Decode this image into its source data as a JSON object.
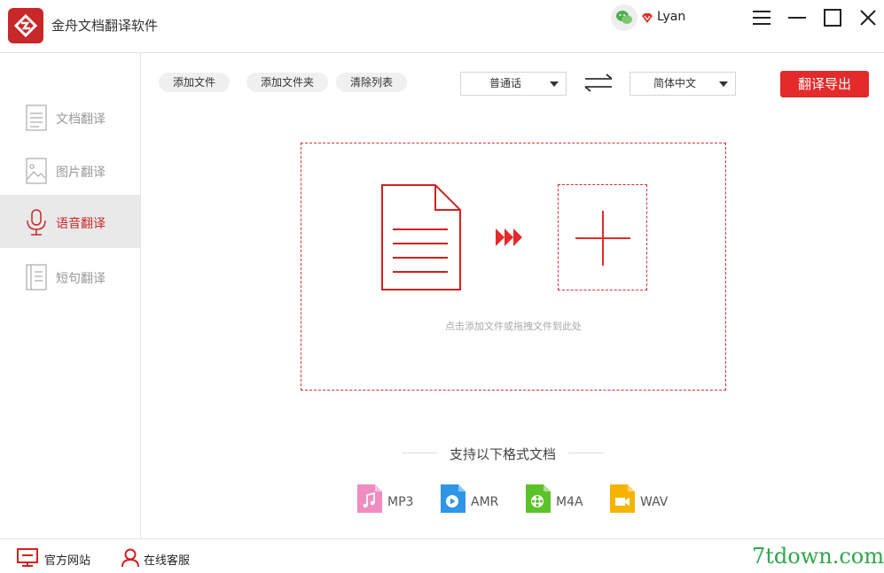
{
  "app": {
    "title": "金舟文档翻译软件",
    "username": "Lyan"
  },
  "sidebar": {
    "items": [
      {
        "label": "文档翻译",
        "icon": "document-icon",
        "active": false
      },
      {
        "label": "图片翻译",
        "icon": "image-icon",
        "active": false
      },
      {
        "label": "语音翻译",
        "icon": "microphone-icon",
        "active": true
      },
      {
        "label": "短句翻译",
        "icon": "text-document-icon",
        "active": false
      }
    ]
  },
  "toolbar": {
    "add_file": "添加文件",
    "add_folder": "添加文件夹",
    "clear_list": "清除列表",
    "source_language": "普通话",
    "target_language": "简体中文",
    "export": "翻译导出"
  },
  "dropzone": {
    "hint": "点击添加文件或拖拽文件到此处"
  },
  "formats": {
    "title": "支持以下格式文档",
    "items": [
      {
        "label": "MP3",
        "icon": "mp3-file-icon",
        "color": "#f08cc0"
      },
      {
        "label": "AMR",
        "icon": "amr-file-icon",
        "color": "#2f95e6"
      },
      {
        "label": "M4A",
        "icon": "m4a-file-icon",
        "color": "#5cc22b"
      },
      {
        "label": "WAV",
        "icon": "wav-file-icon",
        "color": "#f5b400"
      }
    ]
  },
  "footer": {
    "website": "官方网站",
    "support": "在线客服",
    "watermark": "7tdown.com"
  },
  "colors": {
    "accent": "#e42a2a",
    "brand": "#c8282a",
    "dashed_border": "#d43030"
  }
}
